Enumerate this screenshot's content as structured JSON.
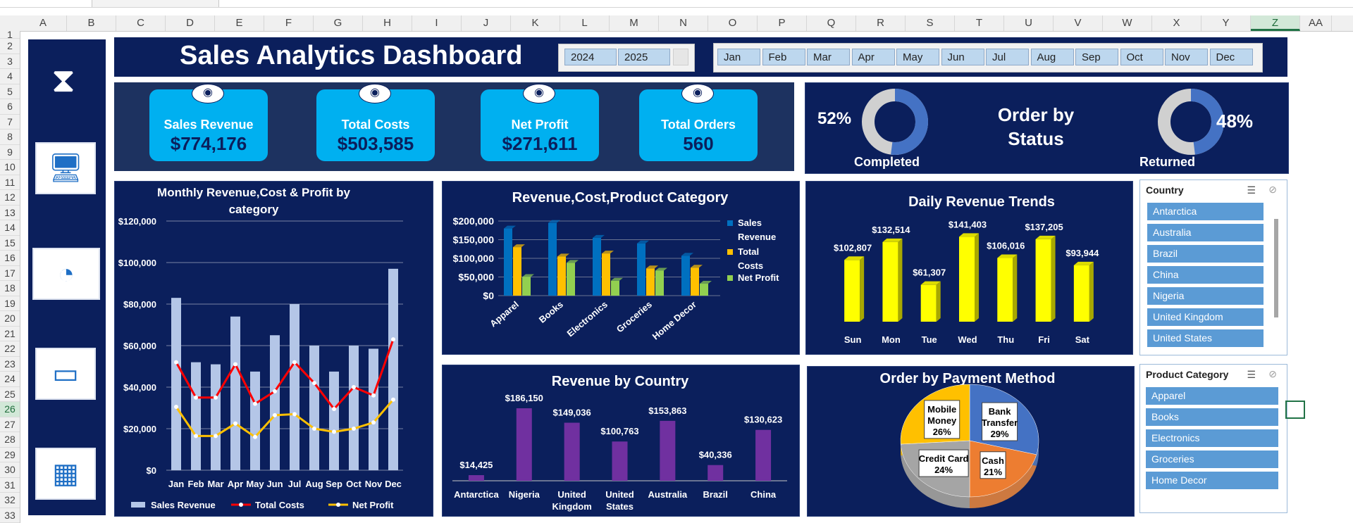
{
  "sheet": {
    "columns": [
      "A",
      "B",
      "C",
      "D",
      "E",
      "F",
      "G",
      "H",
      "I",
      "J",
      "K",
      "L",
      "M",
      "N",
      "O",
      "P",
      "Q",
      "R",
      "S",
      "T",
      "U",
      "V",
      "W",
      "X",
      "Y",
      "Z",
      "AA"
    ],
    "selected_column": "Z",
    "rows": [
      "1",
      "2",
      "3",
      "4",
      "5",
      "6",
      "7",
      "8",
      "9",
      "10",
      "11",
      "12",
      "13",
      "14",
      "15",
      "16",
      "17",
      "18",
      "19",
      "20",
      "21",
      "22",
      "23",
      "24",
      "25",
      "26",
      "27",
      "28",
      "29",
      "30",
      "31",
      "32",
      "33"
    ],
    "selected_row": "26"
  },
  "dashboard": {
    "title": "Sales Analytics Dashboard",
    "years": [
      "2024",
      "2025"
    ],
    "months": [
      "Jan",
      "Feb",
      "Mar",
      "Apr",
      "May",
      "Jun",
      "Jul",
      "Aug",
      "Sep",
      "Oct",
      "Nov",
      "Dec"
    ]
  },
  "sidebar": {
    "icons": [
      "hourglass-icon",
      "monitor-chart-icon",
      "pie-chart-icon",
      "window-icon",
      "database-table-icon"
    ]
  },
  "kpis": [
    {
      "label": "Sales Revenue",
      "value": "$774,176",
      "icon": "money-bag-icon"
    },
    {
      "label": "Total Costs",
      "value": "$503,585",
      "icon": "coins-icon"
    },
    {
      "label": "Net Profit",
      "value": "$271,611",
      "icon": "hand-coin-icon"
    },
    {
      "label": "Total Orders",
      "value": "560",
      "icon": "boxes-icon"
    }
  ],
  "order_status": {
    "title_line1": "Order by",
    "title_line2": "Status",
    "completed_pct": "52%",
    "completed_label": "Completed",
    "completed_value": 52,
    "returned_pct": "48%",
    "returned_label": "Returned",
    "returned_value": 48
  },
  "slicers": {
    "country": {
      "header": "Country",
      "items": [
        "Antarctica",
        "Australia",
        "Brazil",
        "China",
        "Nigeria",
        "United Kingdom",
        "United States"
      ]
    },
    "product_category": {
      "header": "Product Category",
      "items": [
        "Apparel",
        "Books",
        "Electronics",
        "Groceries",
        "Home Decor"
      ]
    }
  },
  "chart_data": [
    {
      "type": "bar",
      "title": "Monthly Revenue,Cost & Profit by category",
      "categories": [
        "Jan",
        "Feb",
        "Mar",
        "Apr",
        "May",
        "Jun",
        "Jul",
        "Aug",
        "Sep",
        "Oct",
        "Nov",
        "Dec"
      ],
      "ytick_labels": [
        "$0",
        "$20,000",
        "$40,000",
        "$60,000",
        "$80,000",
        "$100,000",
        "$120,000"
      ],
      "ylim": [
        0,
        120000
      ],
      "series": [
        {
          "name": "Sales Revenue",
          "kind": "bar",
          "color": "#b4c6e7",
          "values": [
            83000,
            52000,
            51000,
            74000,
            47500,
            65000,
            80000,
            60000,
            47500,
            60000,
            58500,
            97000
          ]
        },
        {
          "name": "Total Costs",
          "kind": "line",
          "color": "#ff0000",
          "values": [
            52000,
            35000,
            35000,
            51000,
            32000,
            38000,
            52000,
            42000,
            29500,
            40000,
            36000,
            63000
          ]
        },
        {
          "name": "Net Profit",
          "kind": "line",
          "color": "#ffc000",
          "values": [
            30500,
            16500,
            16500,
            22500,
            16000,
            26500,
            27000,
            20000,
            18500,
            20000,
            23000,
            34000
          ]
        }
      ]
    },
    {
      "type": "bar",
      "title": "Revenue,Cost,Product Category",
      "categories": [
        "Apparel",
        "Books",
        "Electronics",
        "Groceries",
        "Home Decor"
      ],
      "ytick_labels": [
        "$0",
        "$50,000",
        "$100,000",
        "$150,000",
        "$200,000"
      ],
      "ylim": [
        0,
        200000
      ],
      "series": [
        {
          "name": "Sales Revenue",
          "color": "#0070c0",
          "values": [
            180000,
            195000,
            155000,
            140000,
            107000
          ]
        },
        {
          "name": "Total Costs",
          "color": "#ffc000",
          "values": [
            130000,
            105000,
            113000,
            73000,
            75000
          ]
        },
        {
          "name": "Net Profit",
          "color": "#92d050",
          "values": [
            50000,
            88000,
            40000,
            67000,
            32000
          ]
        }
      ],
      "legend_lines": [
        [
          "Sales",
          "Revenue"
        ],
        [
          "Total",
          "Costs"
        ],
        [
          "Net Profit"
        ]
      ]
    },
    {
      "type": "bar",
      "title": "Daily Revenue Trends",
      "categories": [
        "Sun",
        "Mon",
        "Tue",
        "Wed",
        "Thu",
        "Fri",
        "Sat"
      ],
      "values": [
        102807,
        132514,
        61307,
        141403,
        106016,
        137205,
        93944
      ],
      "data_labels": [
        "$102,807",
        "$132,514",
        "$61,307",
        "$141,403",
        "$106,016",
        "$137,205",
        "$93,944"
      ],
      "color": "#ffff00"
    },
    {
      "type": "bar",
      "title": "Revenue by Country",
      "categories": [
        [
          "Antarctica"
        ],
        [
          "Nigeria"
        ],
        [
          "United",
          "Kingdom"
        ],
        [
          "United",
          "States"
        ],
        [
          "Australia"
        ],
        [
          "Brazil"
        ],
        [
          "China"
        ]
      ],
      "values": [
        14425,
        186150,
        149036,
        100763,
        153863,
        40336,
        130623
      ],
      "data_labels": [
        "$14,425",
        "$186,150",
        "$149,036",
        "$100,763",
        "$153,863",
        "$40,336",
        "$130,623"
      ],
      "color": "#7030a0"
    },
    {
      "type": "pie",
      "title": "Order by Payment Method",
      "slices": [
        {
          "label": [
            "Bank",
            "Transfer",
            "29%"
          ],
          "value": 29,
          "color": "#4472c4"
        },
        {
          "label": [
            "Cash",
            "21%"
          ],
          "value": 21,
          "color": "#ed7d31"
        },
        {
          "label": [
            "Credit Card",
            "24%"
          ],
          "value": 24,
          "color": "#a5a5a5"
        },
        {
          "label": [
            "Mobile",
            "Money",
            "26%"
          ],
          "value": 26,
          "color": "#ffc000"
        }
      ]
    }
  ]
}
